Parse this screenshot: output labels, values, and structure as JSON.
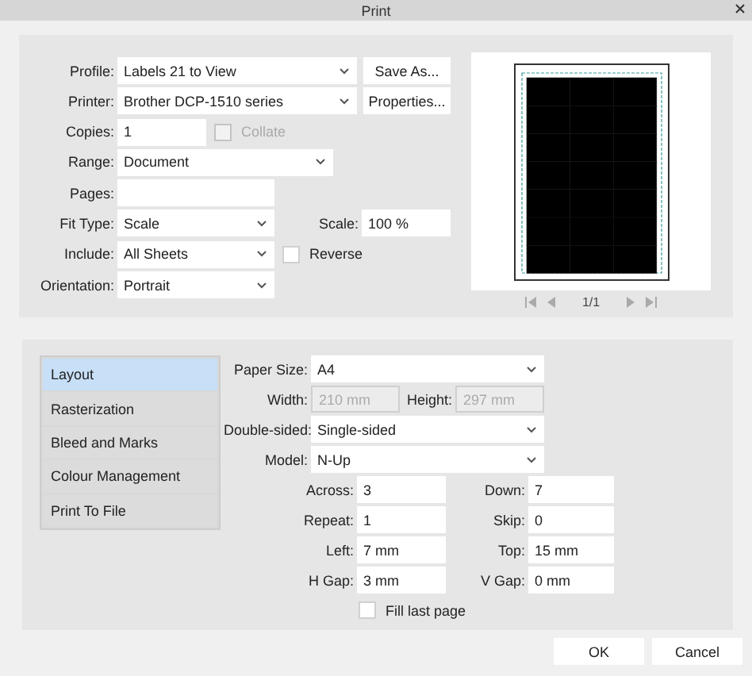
{
  "window": {
    "title": "Print"
  },
  "general": {
    "profile": {
      "label": "Profile:",
      "value": "Labels 21 to View",
      "button": "Save As..."
    },
    "printer": {
      "label": "Printer:",
      "value": "Brother DCP-1510 series",
      "button": "Properties..."
    },
    "copies": {
      "label": "Copies:",
      "value": "1"
    },
    "collate": {
      "label": "Collate",
      "checked": false,
      "disabled": true
    },
    "range": {
      "label": "Range:",
      "value": "Document"
    },
    "pages": {
      "label": "Pages:"
    },
    "fit_type": {
      "label": "Fit Type:",
      "value": "Scale"
    },
    "scale": {
      "label": "Scale:",
      "value": "100 %"
    },
    "include": {
      "label": "Include:",
      "value": "All Sheets"
    },
    "reverse": {
      "label": "Reverse",
      "checked": false
    },
    "orientation": {
      "label": "Orientation:",
      "value": "Portrait"
    }
  },
  "preview": {
    "page_indicator": "1/1"
  },
  "sections": [
    {
      "label": "Layout",
      "selected": true
    },
    {
      "label": "Rasterization",
      "selected": false
    },
    {
      "label": "Bleed and Marks",
      "selected": false
    },
    {
      "label": "Colour Management",
      "selected": false
    },
    {
      "label": "Print To File",
      "selected": false
    }
  ],
  "layout": {
    "paper_size": {
      "label": "Paper Size:",
      "value": "A4"
    },
    "width": {
      "label": "Width:",
      "value": "210 mm",
      "disabled": true
    },
    "height": {
      "label": "Height:",
      "value": "297 mm",
      "disabled": true
    },
    "double_sided": {
      "label": "Double-sided:",
      "value": "Single-sided"
    },
    "model": {
      "label": "Model:",
      "value": "N-Up"
    },
    "grid": [
      {
        "label": "Across:",
        "value": "3"
      },
      {
        "label": "Down:",
        "value": "7"
      },
      {
        "label": "Repeat:",
        "value": "1"
      },
      {
        "label": "Skip:",
        "value": "0"
      },
      {
        "label": "Left:",
        "value": "7 mm"
      },
      {
        "label": "Top:",
        "value": "15 mm"
      },
      {
        "label": "H Gap:",
        "value": "3 mm"
      },
      {
        "label": "V Gap:",
        "value": "0 mm"
      }
    ],
    "fill_last_page": {
      "label": "Fill last page",
      "checked": false
    }
  },
  "buttons": [
    {
      "label": "OK"
    },
    {
      "label": "Cancel"
    }
  ]
}
